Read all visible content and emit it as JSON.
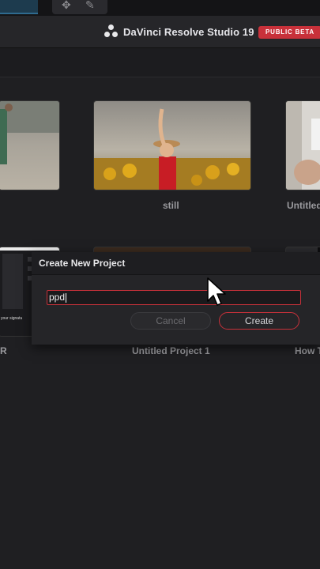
{
  "header": {
    "app_name": "DaVinci Resolve Studio 19",
    "badge": "PUBLIC BETA"
  },
  "projects": [
    {
      "title": "R"
    },
    {
      "title": "still"
    },
    {
      "title": "Untitled"
    },
    {
      "title": "Untitled Project 1"
    },
    {
      "title": "How T"
    }
  ],
  "dialog": {
    "title": "Create New Project",
    "input_value": "ppd",
    "cancel_label": "Cancel",
    "create_label": "Create"
  },
  "thumbnail_text": {
    "snippet": "your signatu"
  },
  "colors": {
    "accent": "#c8313a",
    "background": "#1f1f22"
  }
}
